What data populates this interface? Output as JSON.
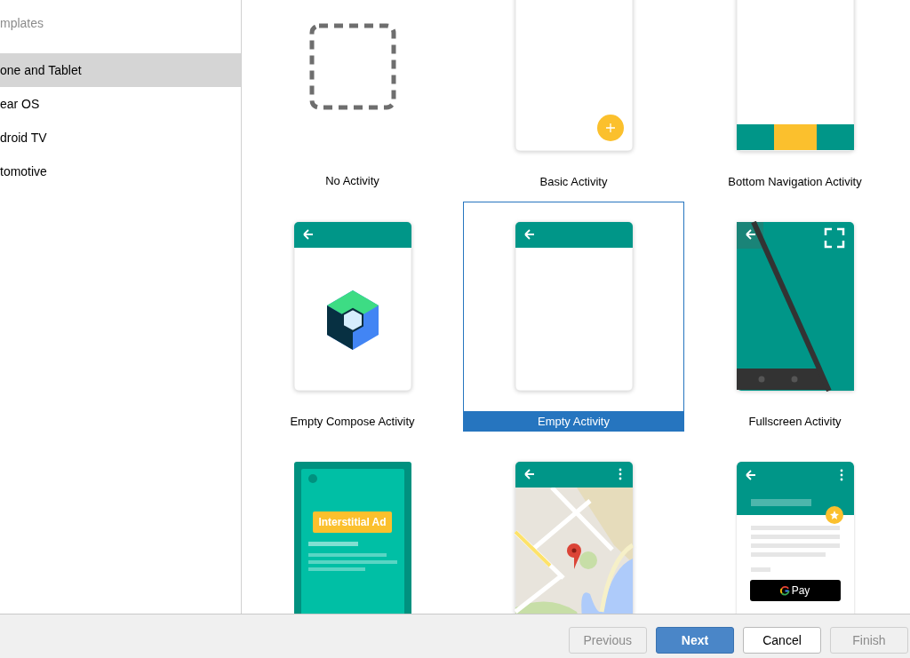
{
  "sidebar": {
    "title": "mplates",
    "items": [
      {
        "label": "one and Tablet",
        "selected": true
      },
      {
        "label": "ear OS",
        "selected": false
      },
      {
        "label": "droid TV",
        "selected": false
      },
      {
        "label": "tomotive",
        "selected": false
      }
    ]
  },
  "templates": [
    {
      "kind": "none",
      "label": "No Activity",
      "selected": false
    },
    {
      "kind": "basic",
      "label": "Basic Activity",
      "selected": false
    },
    {
      "kind": "bottom_nav",
      "label": "Bottom Navigation Activity",
      "selected": false
    },
    {
      "kind": "compose",
      "label": "Empty Compose Activity",
      "selected": false
    },
    {
      "kind": "empty",
      "label": "Empty Activity",
      "selected": true
    },
    {
      "kind": "fullscreen",
      "label": "Fullscreen Activity",
      "selected": false
    },
    {
      "kind": "interstitial",
      "ad_label": "Interstitial Ad",
      "selected": false
    },
    {
      "kind": "maps",
      "selected": false
    },
    {
      "kind": "gpay",
      "pay_label": "Pay",
      "selected": false
    }
  ],
  "buttons": [
    {
      "label": "Previous",
      "kind": "normal",
      "disabled": true
    },
    {
      "label": "Next",
      "kind": "primary",
      "disabled": false
    },
    {
      "label": "Cancel",
      "kind": "normal",
      "disabled": false
    },
    {
      "label": "Finish",
      "kind": "normal",
      "disabled": true
    }
  ]
}
